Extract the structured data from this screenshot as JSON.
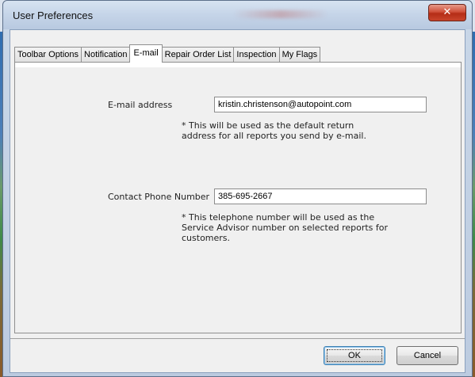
{
  "window": {
    "title": "User Preferences",
    "close_icon_text": "✕"
  },
  "tabs": [
    {
      "label": "Toolbar Options",
      "active": false
    },
    {
      "label": "Notification",
      "active": false
    },
    {
      "label": "E-mail",
      "active": true
    },
    {
      "label": "Repair Order List",
      "active": false
    },
    {
      "label": "Inspection",
      "active": false
    },
    {
      "label": "My Flags",
      "active": false
    }
  ],
  "email_section": {
    "label": "E-mail address",
    "value": "kristin.christenson@autopoint.com",
    "note_line1": "* This will be used as the default return",
    "note_line2": "address for all reports you send by e-mail."
  },
  "phone_section": {
    "label": "Contact Phone Number",
    "value": "385-695-2667",
    "note_line1": "* This telephone number will be used as the",
    "note_line2": "Service Advisor number on selected reports for",
    "note_line3": "customers."
  },
  "buttons": {
    "ok_label": "OK",
    "cancel_label": "Cancel"
  },
  "colors": {
    "titlebar": "#c5d4e8",
    "close_button": "#c8442c",
    "dialog_background": "#f0f0f0"
  }
}
